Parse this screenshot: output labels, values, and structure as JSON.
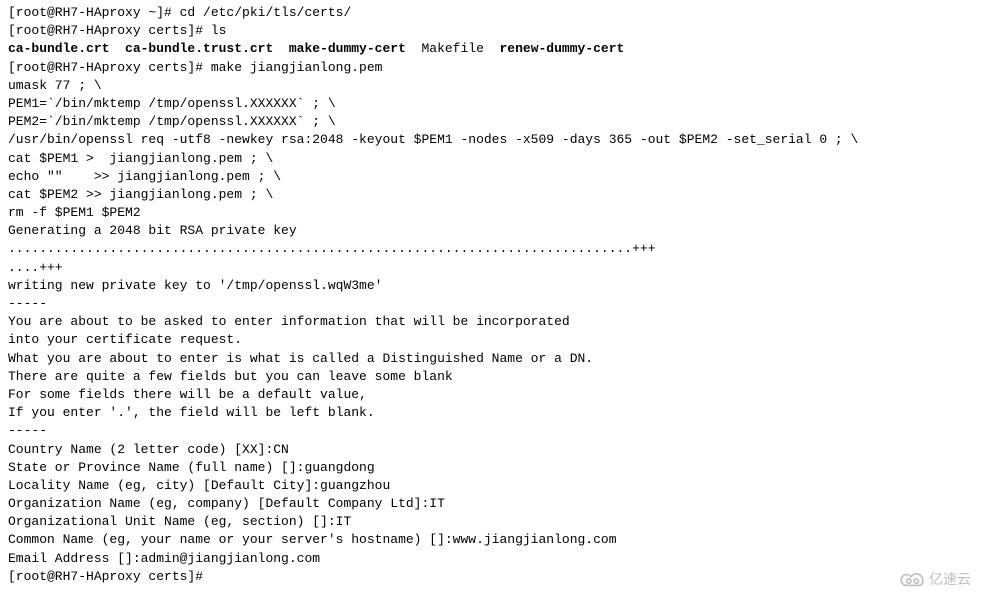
{
  "lines": [
    {
      "t": "[root@RH7-HAproxy ~]# cd /etc/pki/tls/certs/",
      "bold": false
    },
    {
      "t": "[root@RH7-HAproxy certs]# ls",
      "bold": false
    },
    {
      "t": "ca-bundle.crt  ca-bundle.trust.crt  make-dummy-cert  Makefile  renew-dummy-cert",
      "bold": true,
      "mixed": true,
      "parts": [
        {
          "t": "ca-bundle.crt  ca-bundle.trust.crt  make-dummy-cert",
          "bold": true
        },
        {
          "t": "  Makefile  ",
          "bold": false
        },
        {
          "t": "renew-dummy-cert",
          "bold": true
        }
      ]
    },
    {
      "t": "[root@RH7-HAproxy certs]# make jiangjianlong.pem",
      "bold": false
    },
    {
      "t": "umask 77 ; \\",
      "bold": false
    },
    {
      "t": "PEM1=`/bin/mktemp /tmp/openssl.XXXXXX` ; \\",
      "bold": false
    },
    {
      "t": "PEM2=`/bin/mktemp /tmp/openssl.XXXXXX` ; \\",
      "bold": false
    },
    {
      "t": "/usr/bin/openssl req -utf8 -newkey rsa:2048 -keyout $PEM1 -nodes -x509 -days 365 -out $PEM2 -set_serial 0 ; \\",
      "bold": false
    },
    {
      "t": "cat $PEM1 >  jiangjianlong.pem ; \\",
      "bold": false
    },
    {
      "t": "echo \"\"    >> jiangjianlong.pem ; \\",
      "bold": false
    },
    {
      "t": "cat $PEM2 >> jiangjianlong.pem ; \\",
      "bold": false
    },
    {
      "t": "rm -f $PEM1 $PEM2",
      "bold": false
    },
    {
      "t": "Generating a 2048 bit RSA private key",
      "bold": false
    },
    {
      "t": "................................................................................+++",
      "bold": false
    },
    {
      "t": "....+++",
      "bold": false
    },
    {
      "t": "writing new private key to '/tmp/openssl.wqW3me'",
      "bold": false
    },
    {
      "t": "-----",
      "bold": false
    },
    {
      "t": "You are about to be asked to enter information that will be incorporated",
      "bold": false
    },
    {
      "t": "into your certificate request.",
      "bold": false
    },
    {
      "t": "What you are about to enter is what is called a Distinguished Name or a DN.",
      "bold": false
    },
    {
      "t": "There are quite a few fields but you can leave some blank",
      "bold": false
    },
    {
      "t": "For some fields there will be a default value,",
      "bold": false
    },
    {
      "t": "If you enter '.', the field will be left blank.",
      "bold": false
    },
    {
      "t": "-----",
      "bold": false
    },
    {
      "t": "Country Name (2 letter code) [XX]:CN",
      "bold": false
    },
    {
      "t": "State or Province Name (full name) []:guangdong",
      "bold": false
    },
    {
      "t": "Locality Name (eg, city) [Default City]:guangzhou",
      "bold": false
    },
    {
      "t": "Organization Name (eg, company) [Default Company Ltd]:IT",
      "bold": false
    },
    {
      "t": "Organizational Unit Name (eg, section) []:IT",
      "bold": false
    },
    {
      "t": "Common Name (eg, your name or your server's hostname) []:www.jiangjianlong.com",
      "bold": false
    },
    {
      "t": "Email Address []:admin@jiangjianlong.com",
      "bold": false
    },
    {
      "t": "[root@RH7-HAproxy certs]#",
      "bold": false
    }
  ],
  "watermark": {
    "text": "亿速云"
  }
}
